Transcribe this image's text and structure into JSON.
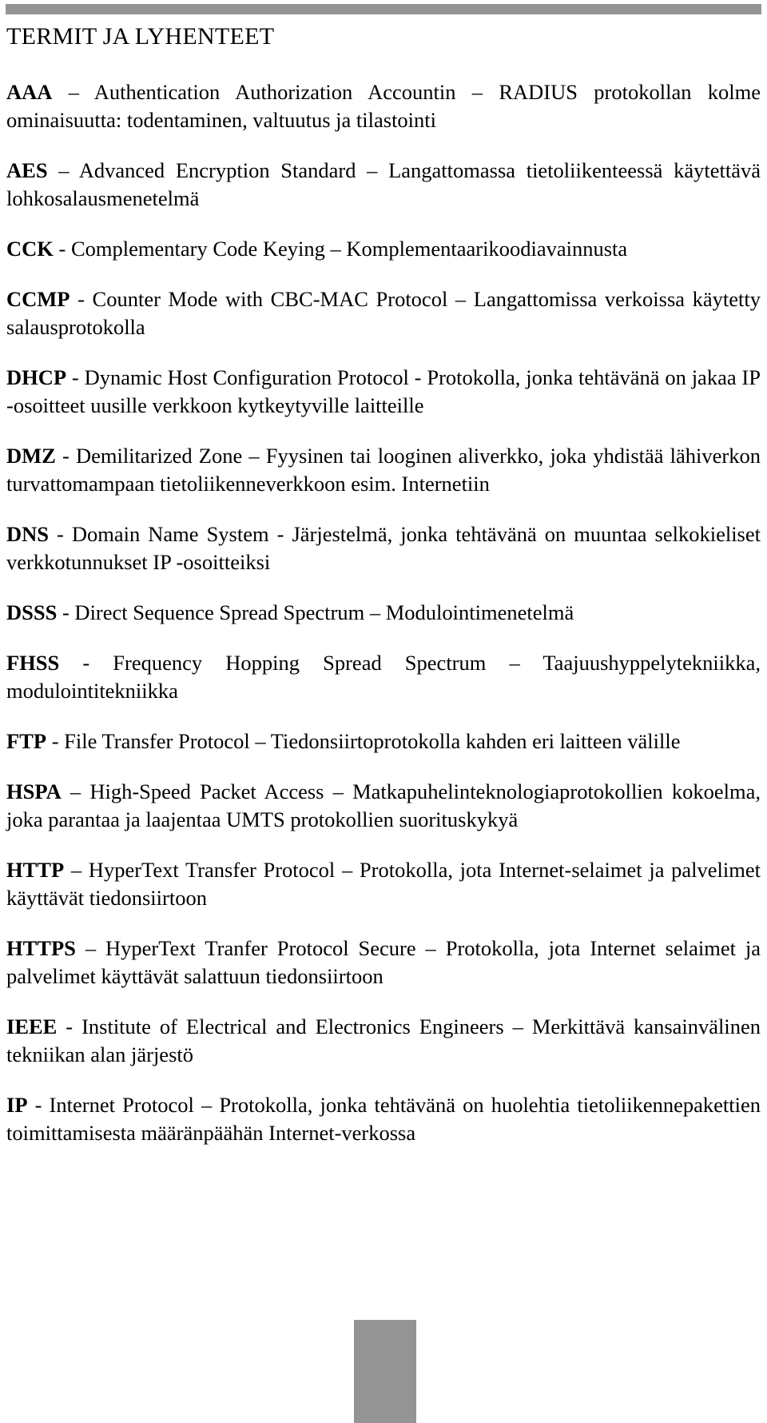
{
  "document": {
    "title": "TERMIT JA LYHENTEET",
    "accent_color": "#949494",
    "text_color": "#000000",
    "background_color": "#ffffff"
  },
  "entries": [
    {
      "term": "AAA",
      "definition": " – Authentication Authorization Accountin – RADIUS protokollan kolme ominaisuutta: todentaminen, valtuutus ja tilastointi"
    },
    {
      "term": "AES",
      "definition": " – Advanced Encryption Standard – Langattomassa tietoliikenteessä käytettävä lohkosalausmenetelmä"
    },
    {
      "term": "CCK",
      "definition": " - Complementary Code Keying – Komplementaarikoodiavainnusta"
    },
    {
      "term": "CCMP",
      "definition": " - Counter Mode with CBC-MAC Protocol – Langattomissa verkoissa käytetty salausprotokolla"
    },
    {
      "term": "DHCP",
      "definition": " - Dynamic Host Configuration Protocol - Protokolla, jonka tehtävänä on jakaa IP -osoitteet uusille verkkoon kytkeytyville laitteille"
    },
    {
      "term": "DMZ",
      "definition": " - Demilitarized Zone – Fyysinen tai looginen aliverkko, joka yhdistää lähiverkon turvattomampaan tietoliikenneverkkoon esim. Internetiin"
    },
    {
      "term": "DNS",
      "definition": " - Domain Name System - Järjestelmä, jonka tehtävänä on muuntaa selkokieliset verkkotunnukset IP -osoitteiksi"
    },
    {
      "term": "DSSS",
      "definition": " - Direct Sequence Spread Spectrum – Modulointimenetelmä"
    },
    {
      "term": "FHSS",
      "definition": " - Frequency Hopping Spread Spectrum – Taajuushyppelytekniikka, modulointitekniikka"
    },
    {
      "term": "FTP",
      "definition": " - File Transfer Protocol – Tiedonsiirtoprotokolla kahden eri laitteen välille"
    },
    {
      "term": "HSPA",
      "definition": " – High-Speed Packet Access – Matkapuhelinteknologiaprotokollien kokoelma, joka parantaa ja laajentaa UMTS protokollien suorituskykyä"
    },
    {
      "term": "HTTP",
      "definition": " – HyperText Transfer Protocol – Protokolla, jota Internet-selaimet ja palvelimet käyttävät tiedonsiirtoon"
    },
    {
      "term": "HTTPS",
      "definition": " – HyperText Tranfer Protocol Secure – Protokolla, jota Internet selaimet ja palvelimet käyttävät salattuun tiedonsiirtoon"
    },
    {
      "term": "IEEE",
      "definition": " - Institute of Electrical and Electronics Engineers – Merkittävä kansainvälinen tekniikan alan järjestö"
    },
    {
      "term": "IP",
      "definition": " - Internet Protocol – Protokolla, jonka tehtävänä on huolehtia tietoliikennepakettien toimittamisesta määränpäähän Internet-verkossa"
    }
  ]
}
